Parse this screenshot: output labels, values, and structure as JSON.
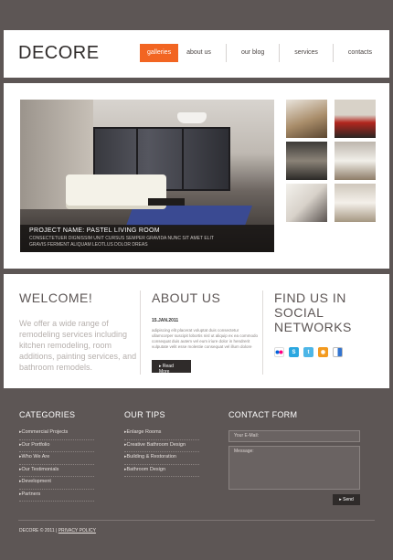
{
  "brand": {
    "logo": "DECORE",
    "accent": "#f26522"
  },
  "nav": [
    {
      "label": "galleries",
      "active": true
    },
    {
      "label": "about us"
    },
    {
      "label": "our blog"
    },
    {
      "label": "services"
    },
    {
      "label": "contacts"
    }
  ],
  "hero": {
    "caption_title": "PROJECT NAME: PASTEL LIVING ROOM",
    "caption_text": "CONSECTETUER DIGNISSIM UNIT CURSUS SEMPER GRAVIDA NUNC SIT AMET ELIT GRAVIS FERMENT ALIQUAM LEOTLUS DOLOR DREAS"
  },
  "welcome": {
    "title": "WELCOME!",
    "text": "We offer a wide range of remodeling services including kitchen remodeling, room additions, painting services, and bathroom remodels."
  },
  "about": {
    "title": "ABOUT US",
    "date": "15.JAN.2011",
    "text": "adipiscing elit placerat voluptat duis consectetur ullamcorper suscipit lobortis nisl ut aliquip ex ea commodo consequat duis autem vel eum iriure dolor in hendrerit vulputate velit esse molestie consequat vel illum dolore",
    "button": "Read More"
  },
  "social": {
    "title": "FIND US IN SOCIAL NETWORKS",
    "icons": [
      "flickr-icon",
      "skype-icon",
      "twitter-icon",
      "rss-icon",
      "delicious-icon"
    ]
  },
  "footer": {
    "categories_title": "CATEGORIES",
    "categories": [
      "Commercial Projects",
      "Our Portfolio",
      "Who We Are",
      "Our Testimonials",
      "Development",
      "Partners"
    ],
    "tips_title": "OUR TIPS",
    "tips": [
      "Enlarge Rooms",
      "Creative Bathroom Design",
      "Building & Restoration",
      "Bathroom Design"
    ],
    "contact_title": "CONTACT FORM",
    "email_placeholder": "Your E-Mail:",
    "message_placeholder": "Message:",
    "send_label": "Send",
    "copyright": "DECORE © 2011 |",
    "privacy": "PRIVACY POLICY"
  }
}
